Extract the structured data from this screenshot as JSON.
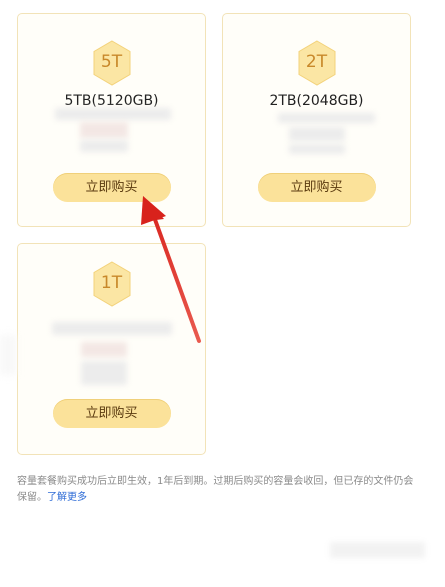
{
  "plans": [
    {
      "id": "5t",
      "badge": "5T",
      "name": "5TB(5120GB)",
      "buy_label": "立即购买"
    },
    {
      "id": "2t",
      "badge": "2T",
      "name": "2TB(2048GB)",
      "buy_label": "立即购买"
    },
    {
      "id": "1t",
      "badge": "1T",
      "name": "",
      "buy_label": "立即购买"
    }
  ],
  "footnote": {
    "text": "容量套餐购买成功后立即生效，1年后到期。过期后购买的容量会收回，但已存的文件仍会保留。",
    "learn_more": "了解更多"
  },
  "colors": {
    "accent_gold": "#c8882a",
    "button_bg": "#fbe29a",
    "card_border": "#f2e3b8",
    "arrow_red": "#e0322d",
    "link_blue": "#2d6bd6"
  }
}
